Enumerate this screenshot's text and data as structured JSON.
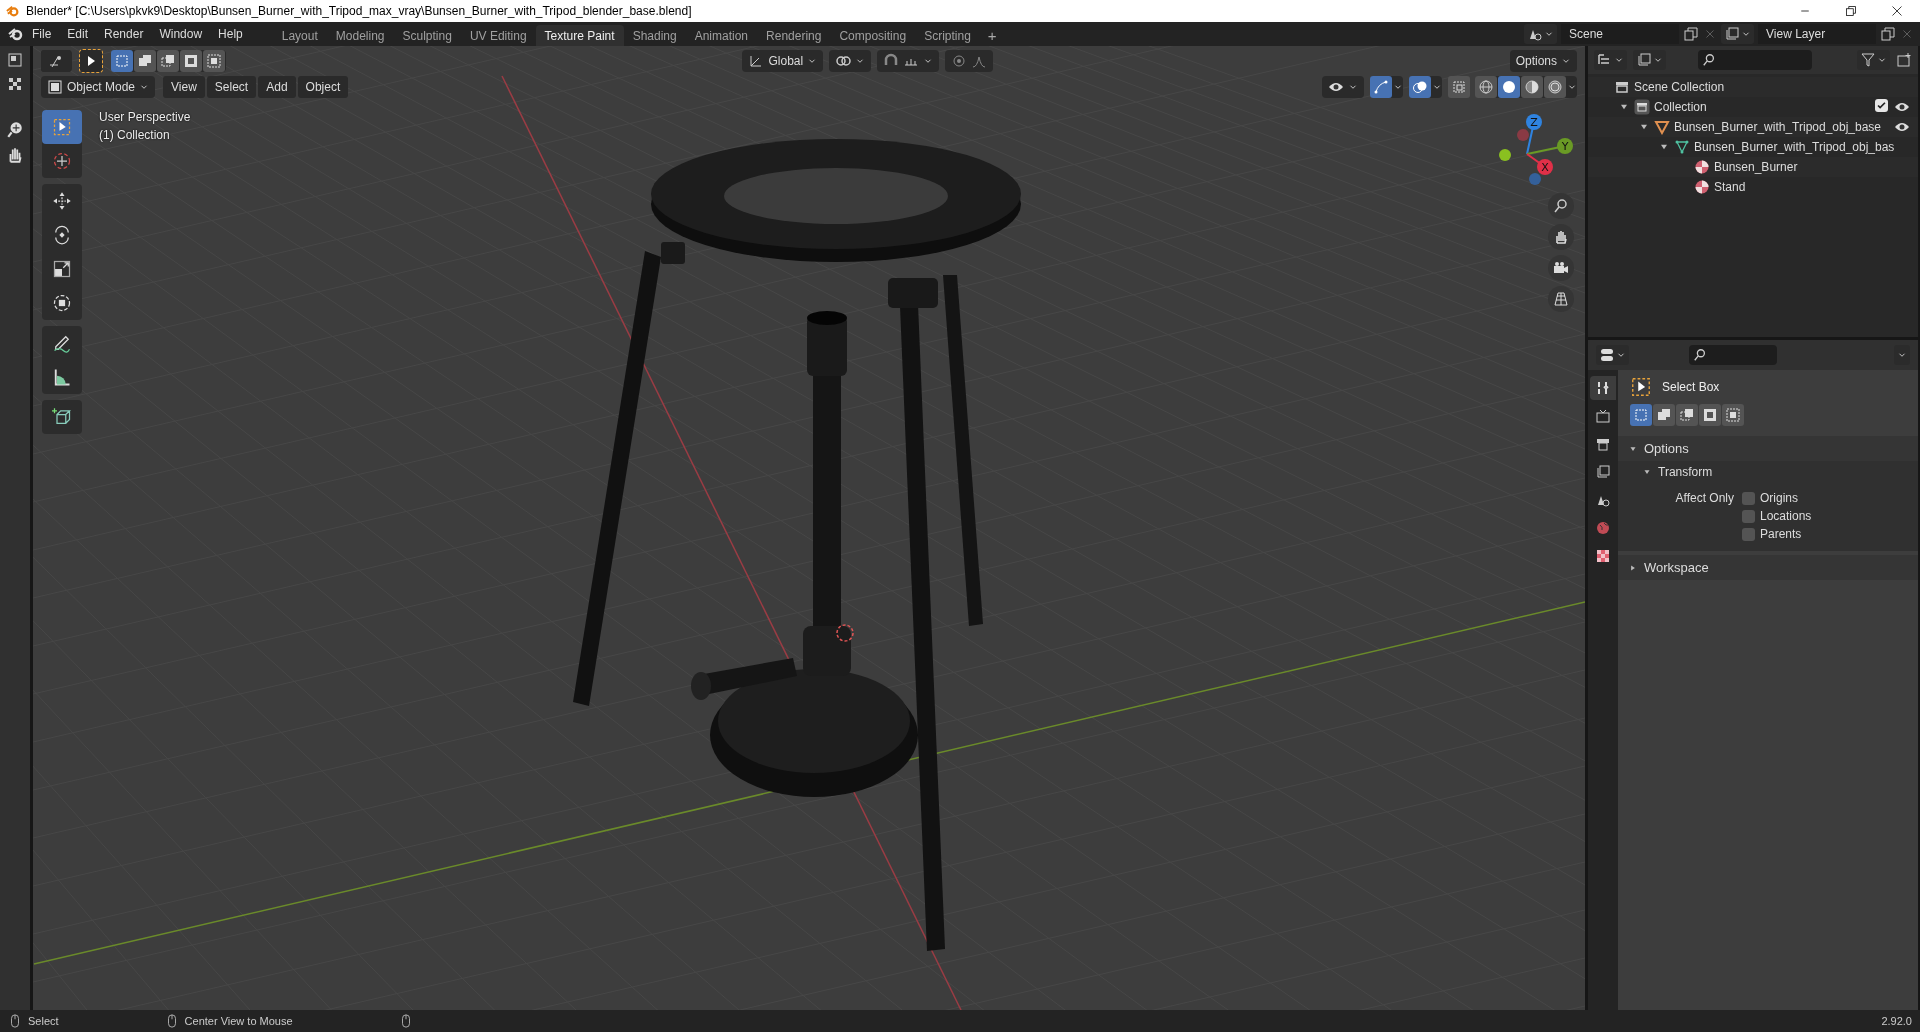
{
  "window": {
    "title": "Blender* [C:\\Users\\pkvk9\\Desktop\\Bunsen_Burner_with_Tripod_max_vray\\Bunsen_Burner_with_Tripod_blender_base.blend]"
  },
  "menu": [
    "File",
    "Edit",
    "Render",
    "Window",
    "Help"
  ],
  "workspaces": [
    {
      "label": "Layout",
      "selected": false
    },
    {
      "label": "Modeling",
      "selected": false
    },
    {
      "label": "Sculpting",
      "selected": false
    },
    {
      "label": "UV Editing",
      "selected": false
    },
    {
      "label": "Texture Paint",
      "selected": true
    },
    {
      "label": "Shading",
      "selected": false
    },
    {
      "label": "Animation",
      "selected": false
    },
    {
      "label": "Rendering",
      "selected": false
    },
    {
      "label": "Compositing",
      "selected": false
    },
    {
      "label": "Scripting",
      "selected": false
    }
  ],
  "add_workspace": "+",
  "scene": {
    "name": "Scene"
  },
  "view_layer": {
    "name": "View Layer"
  },
  "tool_header": {
    "select_modes": [
      {
        "kind": "new",
        "selected": true
      },
      {
        "kind": "extend",
        "selected": false
      },
      {
        "kind": "subtract",
        "selected": false
      },
      {
        "kind": "invert",
        "selected": false
      },
      {
        "kind": "intersect",
        "selected": false
      }
    ],
    "orientation": "Global",
    "options": "Options"
  },
  "viewport_header": {
    "mode": "Object Mode",
    "menus": [
      "View",
      "Select",
      "Add",
      "Object"
    ],
    "shading_modes": [
      {
        "kind": "wireframe",
        "selected": false
      },
      {
        "kind": "solid",
        "selected": true
      },
      {
        "kind": "material",
        "selected": false
      },
      {
        "kind": "rendered",
        "selected": false
      }
    ]
  },
  "viewport": {
    "overlay_text": [
      "User Perspective",
      "(1) Collection"
    ],
    "gizmo_axes": [
      "Z",
      "Y",
      "X"
    ],
    "tools": [
      {
        "kind": "select",
        "selected": true
      },
      {
        "kind": "cursor",
        "selected": false
      },
      {
        "kind": "move",
        "selected": false
      },
      {
        "kind": "rotate",
        "selected": false
      },
      {
        "kind": "scale",
        "selected": false
      },
      {
        "kind": "transform",
        "selected": false
      },
      {
        "kind": "annotate",
        "selected": false
      },
      {
        "kind": "measure",
        "selected": false
      },
      {
        "kind": "add_cube",
        "selected": false
      }
    ]
  },
  "outliner": {
    "tree": [
      {
        "label": "Scene Collection",
        "kind": "scene",
        "children": [
          {
            "label": "Collection",
            "kind": "collection",
            "expanded": true,
            "checked": true,
            "visible": true,
            "children": [
              {
                "label": "Bunsen_Burner_with_Tripod_obj_base",
                "kind": "object",
                "expanded": true,
                "visible": true,
                "children": [
                  {
                    "label": "Bunsen_Burner_with_Tripod_obj_bas",
                    "kind": "mesh",
                    "expanded": true,
                    "children": [
                      {
                        "label": "Bunsen_Burner",
                        "kind": "material"
                      },
                      {
                        "label": "Stand",
                        "kind": "material"
                      }
                    ]
                  }
                ]
              }
            ]
          }
        ]
      }
    ]
  },
  "properties": {
    "tabs": [
      {
        "kind": "tool",
        "selected": true
      },
      {
        "kind": "render",
        "selected": false
      },
      {
        "kind": "output",
        "selected": false
      },
      {
        "kind": "view_layer",
        "selected": false
      },
      {
        "kind": "scene",
        "selected": false
      },
      {
        "kind": "world",
        "selected": false
      },
      {
        "kind": "texture",
        "selected": false
      }
    ],
    "tool_name": "Select Box",
    "select_modes": [
      {
        "kind": "new",
        "selected": true
      },
      {
        "kind": "extend",
        "selected": false
      },
      {
        "kind": "subtract",
        "selected": false
      },
      {
        "kind": "invert",
        "selected": false
      },
      {
        "kind": "intersect",
        "selected": false
      }
    ],
    "panels": [
      {
        "title": "Options",
        "expanded": true,
        "subpanels": [
          {
            "title": "Transform",
            "expanded": true,
            "label": "Affect Only",
            "options": [
              {
                "label": "Origins",
                "checked": false
              },
              {
                "label": "Locations",
                "checked": false
              },
              {
                "label": "Parents",
                "checked": false
              }
            ]
          }
        ]
      },
      {
        "title": "Workspace",
        "expanded": false
      }
    ]
  },
  "status_bar": {
    "hints": [
      "Select",
      "Center View to Mouse"
    ],
    "version": "2.92.0"
  }
}
